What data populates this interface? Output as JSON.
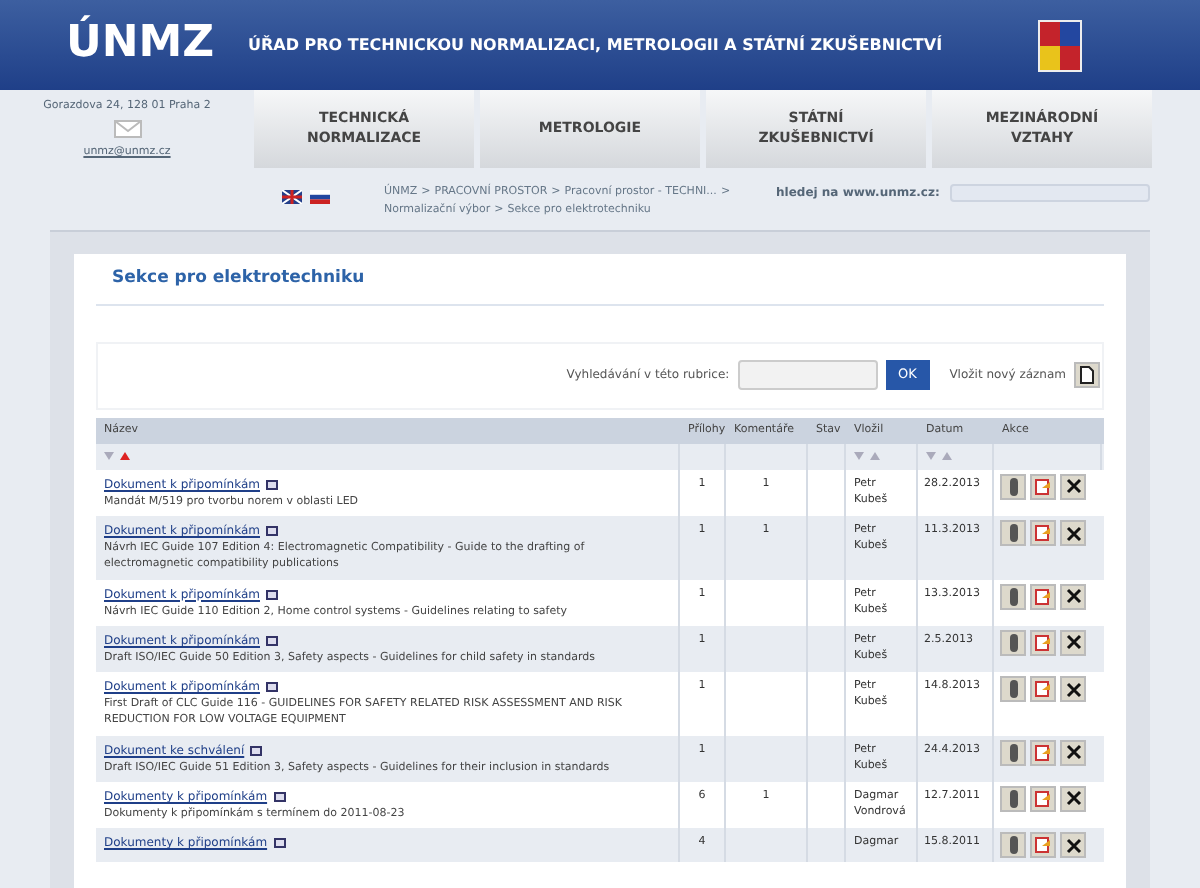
{
  "header": {
    "logo": "ÚNMZ",
    "title": "ÚŘAD PRO TECHNICKOU NORMALIZACI, METROLOGII A STÁTNÍ ZKUŠEBNICTVÍ"
  },
  "contact": {
    "address": "Gorazdova 24, 128 01 Praha 2",
    "email": "unmz@unmz.cz"
  },
  "nav": [
    "TECHNICKÁ NORMALIZACE",
    "METROLOGIE",
    "STÁTNÍ ZKUŠEBNICTVÍ",
    "MEZINÁRODNÍ VZTAHY"
  ],
  "breadcrumb_separator": ">",
  "breadcrumb": [
    "ÚNMZ",
    "PRACOVNÍ PROSTOR",
    "Pracovní prostor - TECHNI...",
    "Normalizační výbor",
    "Sekce pro elektrotechniku"
  ],
  "site_search": {
    "label": "hledej na www.unmz.cz:"
  },
  "page_title": "Sekce pro elektrotechniku",
  "rubric_search": {
    "label": "Vyhledávání v této rubrice:",
    "button": "OK",
    "new_record": "Vložit nový záznam"
  },
  "table": {
    "columns": [
      "Název",
      "Přílohy",
      "Komentáře",
      "Stav",
      "Vložil",
      "Datum",
      "Akce"
    ],
    "rows": [
      {
        "link": "Dokument k připomínkám",
        "description": "Mandát M/519 pro tvorbu norem v oblasti LED",
        "attachments": "1",
        "comments": "1",
        "author": "Petr Kubeš",
        "date": "28.2.2013"
      },
      {
        "link": "Dokument k připomínkám",
        "description": "Návrh IEC Guide 107 Edition 4: Electromagnetic Compatibility - Guide to the drafting of electromagnetic compatibility publications",
        "attachments": "1",
        "comments": "1",
        "author": "Petr Kubeš",
        "date": "11.3.2013"
      },
      {
        "link": "Dokument k připomínkám",
        "description": "Návrh IEC Guide 110 Edition 2, Home control systems - Guidelines relating to safety",
        "attachments": "1",
        "author": "Petr Kubeš",
        "date": "13.3.2013"
      },
      {
        "link": "Dokument k připomínkám",
        "description": "Draft ISO/IEC Guide 50 Edition 3, Safety aspects - Guidelines for child safety in standards",
        "attachments": "1",
        "author": "Petr Kubeš",
        "date": "2.5.2013"
      },
      {
        "link": "Dokument k připomínkám",
        "description": "First Draft of CLC Guide 116 - GUIDELINES FOR SAFETY RELATED RISK ASSESSMENT AND RISK REDUCTION FOR LOW VOLTAGE EQUIPMENT",
        "attachments": "1",
        "author": "Petr Kubeš",
        "date": "14.8.2013"
      },
      {
        "link": "Dokument ke schválení",
        "description": "Draft ISO/IEC Guide 51 Edition 3, Safety aspects - Guidelines for their inclusion in standards",
        "attachments": "1",
        "author": "Petr Kubeš",
        "date": "24.4.2013"
      },
      {
        "link": "Dokumenty k připomínkám",
        "description": "Dokumenty k připomínkám s termínem do 2011-08-23",
        "attachments": "6",
        "comments": "1",
        "author": "Dagmar Vondrová",
        "date": "12.7.2011"
      },
      {
        "link": "Dokumenty k připomínkám",
        "attachments": "4",
        "author": "Dagmar",
        "date": "15.8.2011"
      }
    ]
  }
}
